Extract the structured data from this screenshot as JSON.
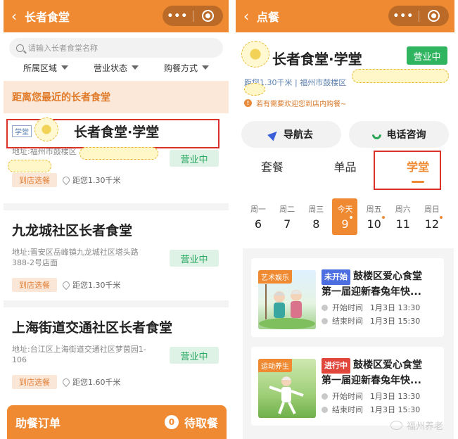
{
  "left": {
    "header": {
      "back": "‹",
      "title": "长者食堂"
    },
    "search": {
      "placeholder": "请输入长者食堂名称"
    },
    "filters": [
      "所属区域",
      "营业状态",
      "购餐方式"
    ],
    "nearest_label": "距离您最近的长者食堂",
    "cards": [
      {
        "tag": "学堂",
        "name": "长者食堂·学堂",
        "addr_line1": "地址:福州市鼓楼区",
        "addr_line2": "",
        "status": "营业中",
        "visit": "到店选餐",
        "distance": "距您1.30千米"
      },
      {
        "name": "九龙城社区长者食堂",
        "addr_line1": "地址:晋安区岳峰镇九龙城社区塔头路",
        "addr_line2": "388-2号店面",
        "status": "营业中",
        "visit": "到店选餐",
        "distance": "距您1.30千米"
      },
      {
        "name": "上海街道交通社区长者食堂",
        "addr_line1": "地址:台江区上海街道交通社区梦茵园1-",
        "addr_line2": "106",
        "status": "营业中",
        "visit": "到店选餐",
        "distance": "距您1.60千米"
      }
    ],
    "bottom": {
      "label": "助餐订单",
      "count": "0",
      "action": "待取餐"
    }
  },
  "right": {
    "header": {
      "back": "‹",
      "title": "点餐"
    },
    "canteen_name": "长者食堂·学堂",
    "status": "营业中",
    "meta": "距您1.30千米 | 福州市鼓楼区",
    "notice": "若有需要欢迎您到店内购餐~",
    "buttons": {
      "navigate": "导航去",
      "call": "电话咨询"
    },
    "tabs": [
      "套餐",
      "单品",
      "学堂"
    ],
    "week": [
      {
        "wd": "周一",
        "dn": "6",
        "dot": false
      },
      {
        "wd": "周二",
        "dn": "7",
        "dot": false
      },
      {
        "wd": "周三",
        "dn": "8",
        "dot": false
      },
      {
        "wd": "今天",
        "dn": "9",
        "dot": true
      },
      {
        "wd": "周五",
        "dn": "10",
        "dot": true
      },
      {
        "wd": "周六",
        "dn": "11",
        "dot": false
      },
      {
        "wd": "周日",
        "dn": "12",
        "dot": true
      }
    ],
    "events": [
      {
        "category": "艺术娱乐",
        "status": "未开始",
        "status_color": "#4c6ee0",
        "title1": "鼓楼区爱心食堂",
        "title2": "第一届迎新春兔年快...",
        "start_label": "开始时间",
        "start": "1月3日 13:30",
        "end_label": "结束时间",
        "end": "1月3日 15:30"
      },
      {
        "category": "运动养生",
        "status": "进行中",
        "status_color": "#e0463a",
        "title1": "鼓楼区爱心食堂",
        "title2": "第一届迎新春兔年快...",
        "start_label": "开始时间",
        "start": "1月3日 13:30",
        "end_label": "结束时间",
        "end": "1月3日 15:30"
      }
    ],
    "watermark": "福州养老"
  },
  "colors": {
    "accent": "#f08a32",
    "open_green": "#27a760",
    "not_started": "#4c6ee0",
    "ongoing": "#e0463a"
  }
}
